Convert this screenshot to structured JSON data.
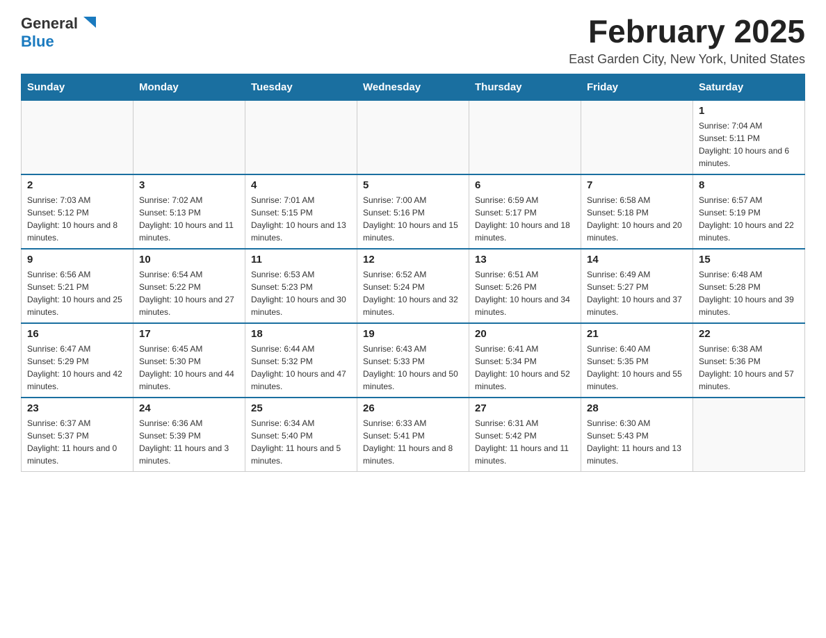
{
  "logo": {
    "text_general": "General",
    "text_blue": "Blue",
    "triangle_color": "#1a7abf"
  },
  "header": {
    "title": "February 2025",
    "subtitle": "East Garden City, New York, United States"
  },
  "weekdays": [
    "Sunday",
    "Monday",
    "Tuesday",
    "Wednesday",
    "Thursday",
    "Friday",
    "Saturday"
  ],
  "weeks": [
    [
      {
        "day": "",
        "info": ""
      },
      {
        "day": "",
        "info": ""
      },
      {
        "day": "",
        "info": ""
      },
      {
        "day": "",
        "info": ""
      },
      {
        "day": "",
        "info": ""
      },
      {
        "day": "",
        "info": ""
      },
      {
        "day": "1",
        "info": "Sunrise: 7:04 AM\nSunset: 5:11 PM\nDaylight: 10 hours and 6 minutes."
      }
    ],
    [
      {
        "day": "2",
        "info": "Sunrise: 7:03 AM\nSunset: 5:12 PM\nDaylight: 10 hours and 8 minutes."
      },
      {
        "day": "3",
        "info": "Sunrise: 7:02 AM\nSunset: 5:13 PM\nDaylight: 10 hours and 11 minutes."
      },
      {
        "day": "4",
        "info": "Sunrise: 7:01 AM\nSunset: 5:15 PM\nDaylight: 10 hours and 13 minutes."
      },
      {
        "day": "5",
        "info": "Sunrise: 7:00 AM\nSunset: 5:16 PM\nDaylight: 10 hours and 15 minutes."
      },
      {
        "day": "6",
        "info": "Sunrise: 6:59 AM\nSunset: 5:17 PM\nDaylight: 10 hours and 18 minutes."
      },
      {
        "day": "7",
        "info": "Sunrise: 6:58 AM\nSunset: 5:18 PM\nDaylight: 10 hours and 20 minutes."
      },
      {
        "day": "8",
        "info": "Sunrise: 6:57 AM\nSunset: 5:19 PM\nDaylight: 10 hours and 22 minutes."
      }
    ],
    [
      {
        "day": "9",
        "info": "Sunrise: 6:56 AM\nSunset: 5:21 PM\nDaylight: 10 hours and 25 minutes."
      },
      {
        "day": "10",
        "info": "Sunrise: 6:54 AM\nSunset: 5:22 PM\nDaylight: 10 hours and 27 minutes."
      },
      {
        "day": "11",
        "info": "Sunrise: 6:53 AM\nSunset: 5:23 PM\nDaylight: 10 hours and 30 minutes."
      },
      {
        "day": "12",
        "info": "Sunrise: 6:52 AM\nSunset: 5:24 PM\nDaylight: 10 hours and 32 minutes."
      },
      {
        "day": "13",
        "info": "Sunrise: 6:51 AM\nSunset: 5:26 PM\nDaylight: 10 hours and 34 minutes."
      },
      {
        "day": "14",
        "info": "Sunrise: 6:49 AM\nSunset: 5:27 PM\nDaylight: 10 hours and 37 minutes."
      },
      {
        "day": "15",
        "info": "Sunrise: 6:48 AM\nSunset: 5:28 PM\nDaylight: 10 hours and 39 minutes."
      }
    ],
    [
      {
        "day": "16",
        "info": "Sunrise: 6:47 AM\nSunset: 5:29 PM\nDaylight: 10 hours and 42 minutes."
      },
      {
        "day": "17",
        "info": "Sunrise: 6:45 AM\nSunset: 5:30 PM\nDaylight: 10 hours and 44 minutes."
      },
      {
        "day": "18",
        "info": "Sunrise: 6:44 AM\nSunset: 5:32 PM\nDaylight: 10 hours and 47 minutes."
      },
      {
        "day": "19",
        "info": "Sunrise: 6:43 AM\nSunset: 5:33 PM\nDaylight: 10 hours and 50 minutes."
      },
      {
        "day": "20",
        "info": "Sunrise: 6:41 AM\nSunset: 5:34 PM\nDaylight: 10 hours and 52 minutes."
      },
      {
        "day": "21",
        "info": "Sunrise: 6:40 AM\nSunset: 5:35 PM\nDaylight: 10 hours and 55 minutes."
      },
      {
        "day": "22",
        "info": "Sunrise: 6:38 AM\nSunset: 5:36 PM\nDaylight: 10 hours and 57 minutes."
      }
    ],
    [
      {
        "day": "23",
        "info": "Sunrise: 6:37 AM\nSunset: 5:37 PM\nDaylight: 11 hours and 0 minutes."
      },
      {
        "day": "24",
        "info": "Sunrise: 6:36 AM\nSunset: 5:39 PM\nDaylight: 11 hours and 3 minutes."
      },
      {
        "day": "25",
        "info": "Sunrise: 6:34 AM\nSunset: 5:40 PM\nDaylight: 11 hours and 5 minutes."
      },
      {
        "day": "26",
        "info": "Sunrise: 6:33 AM\nSunset: 5:41 PM\nDaylight: 11 hours and 8 minutes."
      },
      {
        "day": "27",
        "info": "Sunrise: 6:31 AM\nSunset: 5:42 PM\nDaylight: 11 hours and 11 minutes."
      },
      {
        "day": "28",
        "info": "Sunrise: 6:30 AM\nSunset: 5:43 PM\nDaylight: 11 hours and 13 minutes."
      },
      {
        "day": "",
        "info": ""
      }
    ]
  ]
}
